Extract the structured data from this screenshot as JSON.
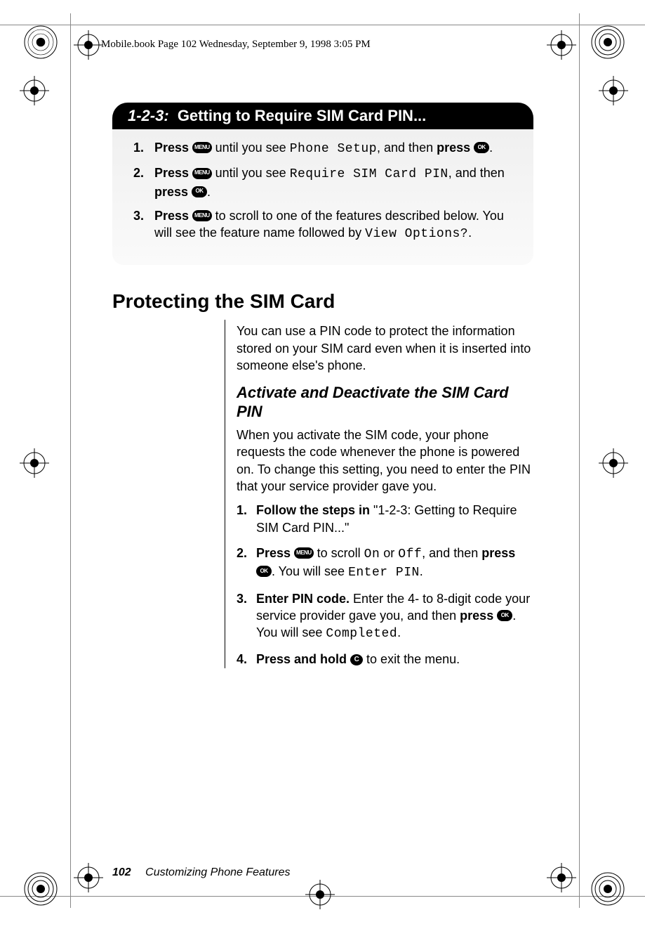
{
  "meta": {
    "header": "Mobile.book  Page 102  Wednesday, September 9, 1998  3:05 PM"
  },
  "buttons": {
    "menu": "MENU",
    "ok": "OK",
    "c": "C"
  },
  "box": {
    "prefix": "1-2-3:",
    "title": "Getting to Require SIM Card PIN...",
    "steps": [
      {
        "n": "1.",
        "a1": "Press ",
        "btn1": "menu",
        "a2": " until you see ",
        "d1": "Phone Setup",
        "a3": ", and then ",
        "b1": "press ",
        "btn2": "ok",
        "a4": "."
      },
      {
        "n": "2.",
        "a1": "Press ",
        "btn1": "menu",
        "a2": " until you see ",
        "d1": "Require SIM Card PIN",
        "a3": ", and then ",
        "b1": "press ",
        "btn2": "ok",
        "a4": "."
      },
      {
        "n": "3.",
        "a1": "Press ",
        "btn1": "menu",
        "a2": " to scroll to one of the features described below. You will see the feature name followed by ",
        "d1": "View Options?",
        "a4": "."
      }
    ]
  },
  "section": {
    "heading": "Protecting the SIM Card",
    "intro": "You can use a PIN code to protect the information stored on your SIM card even when it is inserted into someone else's phone.",
    "subheading": "Activate and Deactivate the SIM Card PIN",
    "subintro": "When you activate the SIM code, your phone requests the code whenever the phone is powered on. To change this setting, you need to enter the PIN that your service provider gave you.",
    "steps": {
      "s1n": "1.",
      "s1b": "Follow the steps in ",
      "s1t": "\"1-2-3: Getting to Require SIM Card PIN...\"",
      "s2n": "2.",
      "s2b1": "Press ",
      "s2t1": " to scroll ",
      "s2d1": "On",
      "s2t2": " or ",
      "s2d2": "Off",
      "s2t3": ", and then ",
      "s2b2": "press ",
      "s2t4": ". You will see ",
      "s2d3": "Enter PIN",
      "s2t5": ".",
      "s3n": "3.",
      "s3b1": "Enter PIN code. ",
      "s3t1": "Enter the 4- to 8-digit code your service provider gave you, and then ",
      "s3b2": "press ",
      "s3t2": ". You will see ",
      "s3d1": "Completed",
      "s3t3": ".",
      "s4n": "4.",
      "s4b1": "Press and hold ",
      "s4t1": " to exit the menu."
    }
  },
  "footer": {
    "page": "102",
    "chapter": "Customizing Phone Features"
  }
}
